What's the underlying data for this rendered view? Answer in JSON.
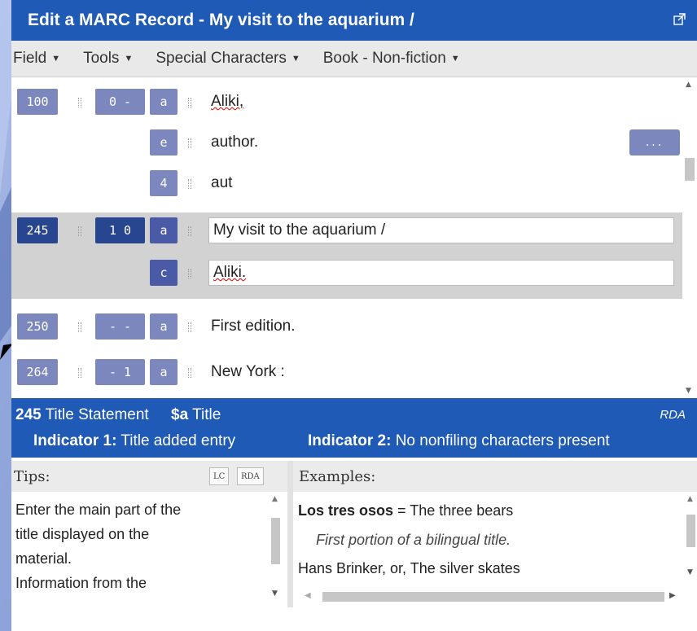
{
  "window": {
    "title": "Edit a MARC Record - My visit to the aquarium /",
    "popout_icon": "external-link-icon"
  },
  "menus": [
    {
      "label": "Field"
    },
    {
      "label": "Tools"
    },
    {
      "label": "Special Characters"
    },
    {
      "label": "Book - Non-fiction"
    }
  ],
  "fields": [
    {
      "tag": "100",
      "indicators": "0 -",
      "subfields": [
        {
          "code": "a",
          "value": "Aliki,"
        },
        {
          "code": "e",
          "value": "author."
        },
        {
          "code": "4",
          "value": "aut"
        }
      ]
    },
    {
      "tag": "245",
      "indicators": "1 0",
      "selected": true,
      "subfields": [
        {
          "code": "a",
          "value": "My visit to the aquarium /"
        },
        {
          "code": "c",
          "value": "Aliki."
        }
      ]
    },
    {
      "tag": "250",
      "indicators": "- -",
      "subfields": [
        {
          "code": "a",
          "value": "First edition."
        }
      ]
    },
    {
      "tag": "264",
      "indicators": "- 1",
      "subfields": [
        {
          "code": "a",
          "value": "New York :"
        }
      ]
    }
  ],
  "more_button": "...",
  "info": {
    "tag": "245",
    "field_name": "Title Statement",
    "subfield_code": "$a",
    "subfield_name": "Title",
    "standard": "RDA",
    "ind1_label": "Indicator 1:",
    "ind1_value": "Title added entry",
    "ind2_label": "Indicator 2:",
    "ind2_value": "No nonfiling characters present"
  },
  "tips": {
    "heading": "Tips:",
    "lc_button": "LC",
    "rda_button": "RDA",
    "lines": [
      "Enter the main part of the",
      "title displayed on the",
      "material.",
      "Information from the"
    ]
  },
  "examples": {
    "heading": "Examples:",
    "ex1_bold": "Los tres osos",
    "ex1_rest": " = The three bears",
    "ex1_note": "First portion of a bilingual title.",
    "ex2": "Hans Brinker, or, The silver skates"
  },
  "colors": {
    "header_blue": "#1f5ab6",
    "tag_box": "#7c87be",
    "tag_box_selected": "#4a5aa6",
    "tag_box_active": "#27468f"
  }
}
